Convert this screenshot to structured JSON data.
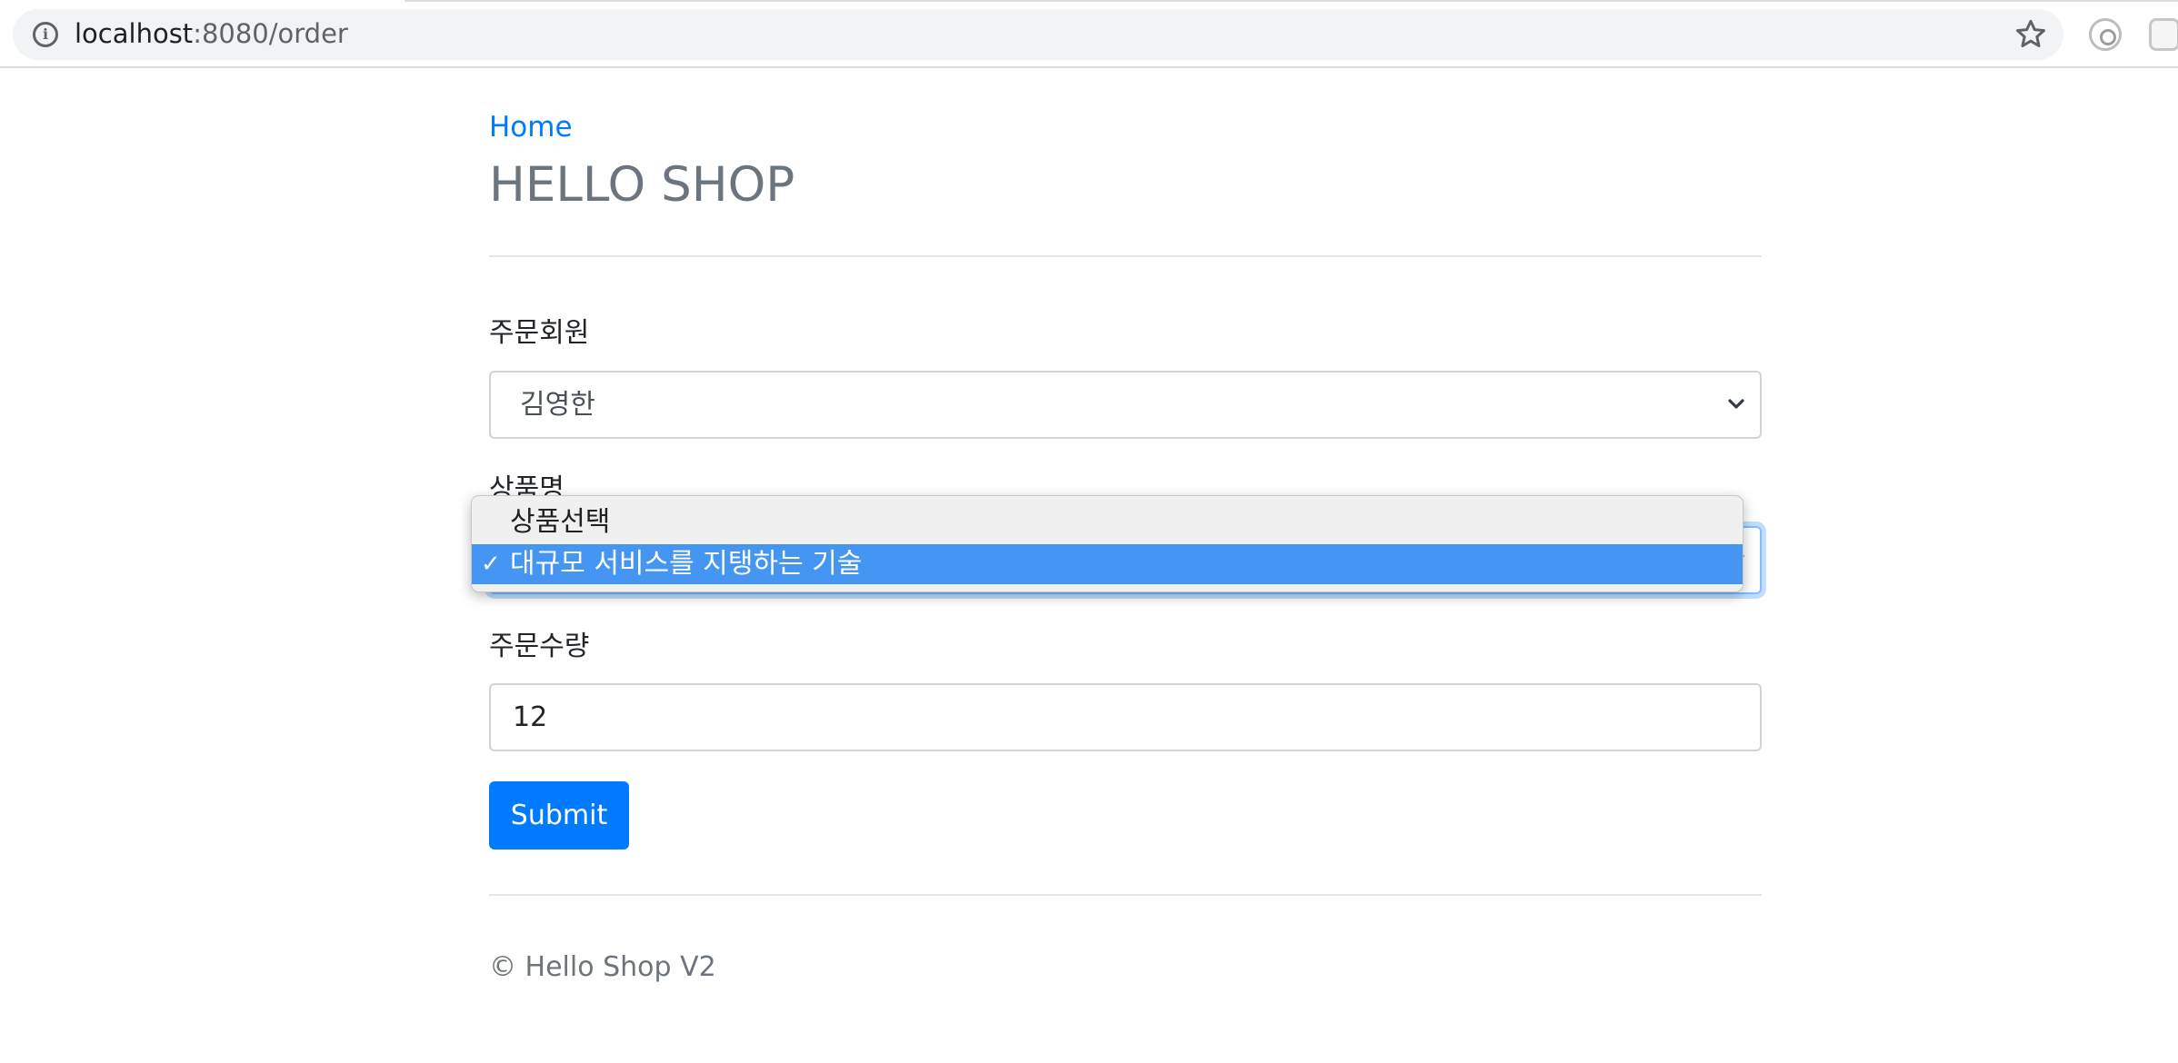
{
  "browser": {
    "url_host": "localhost",
    "url_path": ":8080/order"
  },
  "header": {
    "home_link": "Home",
    "title": "HELLO SHOP"
  },
  "form": {
    "member_label": "주문회원",
    "member_selected": "김영한",
    "item_label": "상품명",
    "item_options": [
      "상품선택",
      "대규모 서비스를 지탱하는 기술"
    ],
    "item_selected_index": 1,
    "count_label": "주문수량",
    "count_value": "12",
    "submit_label": "Submit"
  },
  "dropdown": {
    "check_glyph": "✓"
  },
  "footer": {
    "text": "© Hello Shop V2"
  },
  "colors": {
    "primary": "#007bff",
    "muted": "#6c757d",
    "dropdown_highlight": "#4596f2"
  }
}
